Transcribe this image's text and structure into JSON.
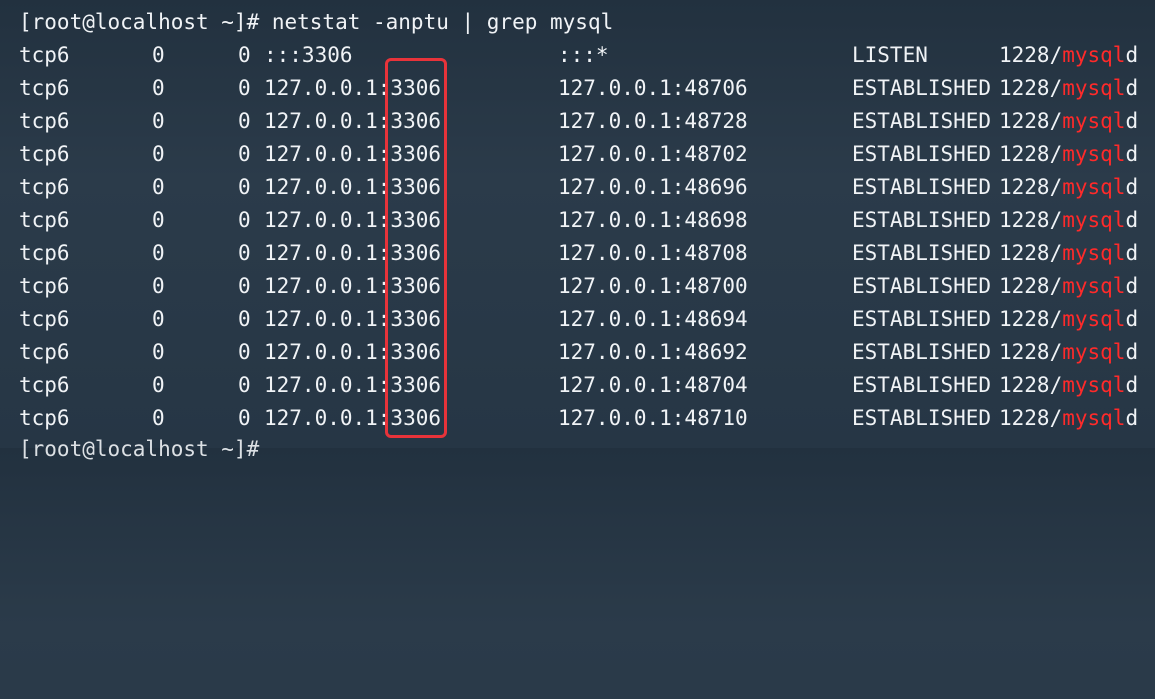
{
  "terminal": {
    "prompt": "[root@localhost ~]# netstat -anptu | grep mysql",
    "partial_next_prompt": "[root@localhost ~]#",
    "highlight_color": "#e8333a",
    "match_color": "#ff2a2a",
    "rows": [
      {
        "proto": "tcp6",
        "recvq": "0",
        "sendq": "0",
        "local": ":::3306",
        "foreign": ":::*",
        "state": "LISTEN",
        "pid": "1228/",
        "prog": "mysql",
        "suffix": "d"
      },
      {
        "proto": "tcp6",
        "recvq": "0",
        "sendq": "0",
        "local": "127.0.0.1:3306",
        "foreign": "127.0.0.1:48706",
        "state": "ESTABLISHED",
        "pid": "1228/",
        "prog": "mysql",
        "suffix": "d"
      },
      {
        "proto": "tcp6",
        "recvq": "0",
        "sendq": "0",
        "local": "127.0.0.1:3306",
        "foreign": "127.0.0.1:48728",
        "state": "ESTABLISHED",
        "pid": "1228/",
        "prog": "mysql",
        "suffix": "d"
      },
      {
        "proto": "tcp6",
        "recvq": "0",
        "sendq": "0",
        "local": "127.0.0.1:3306",
        "foreign": "127.0.0.1:48702",
        "state": "ESTABLISHED",
        "pid": "1228/",
        "prog": "mysql",
        "suffix": "d"
      },
      {
        "proto": "tcp6",
        "recvq": "0",
        "sendq": "0",
        "local": "127.0.0.1:3306",
        "foreign": "127.0.0.1:48696",
        "state": "ESTABLISHED",
        "pid": "1228/",
        "prog": "mysql",
        "suffix": "d"
      },
      {
        "proto": "tcp6",
        "recvq": "0",
        "sendq": "0",
        "local": "127.0.0.1:3306",
        "foreign": "127.0.0.1:48698",
        "state": "ESTABLISHED",
        "pid": "1228/",
        "prog": "mysql",
        "suffix": "d"
      },
      {
        "proto": "tcp6",
        "recvq": "0",
        "sendq": "0",
        "local": "127.0.0.1:3306",
        "foreign": "127.0.0.1:48708",
        "state": "ESTABLISHED",
        "pid": "1228/",
        "prog": "mysql",
        "suffix": "d"
      },
      {
        "proto": "tcp6",
        "recvq": "0",
        "sendq": "0",
        "local": "127.0.0.1:3306",
        "foreign": "127.0.0.1:48700",
        "state": "ESTABLISHED",
        "pid": "1228/",
        "prog": "mysql",
        "suffix": "d"
      },
      {
        "proto": "tcp6",
        "recvq": "0",
        "sendq": "0",
        "local": "127.0.0.1:3306",
        "foreign": "127.0.0.1:48694",
        "state": "ESTABLISHED",
        "pid": "1228/",
        "prog": "mysql",
        "suffix": "d"
      },
      {
        "proto": "tcp6",
        "recvq": "0",
        "sendq": "0",
        "local": "127.0.0.1:3306",
        "foreign": "127.0.0.1:48692",
        "state": "ESTABLISHED",
        "pid": "1228/",
        "prog": "mysql",
        "suffix": "d"
      },
      {
        "proto": "tcp6",
        "recvq": "0",
        "sendq": "0",
        "local": "127.0.0.1:3306",
        "foreign": "127.0.0.1:48704",
        "state": "ESTABLISHED",
        "pid": "1228/",
        "prog": "mysql",
        "suffix": "d"
      },
      {
        "proto": "tcp6",
        "recvq": "0",
        "sendq": "0",
        "local": "127.0.0.1:3306",
        "foreign": "127.0.0.1:48710",
        "state": "ESTABLISHED",
        "pid": "1228/",
        "prog": "mysql",
        "suffix": "d"
      }
    ]
  }
}
